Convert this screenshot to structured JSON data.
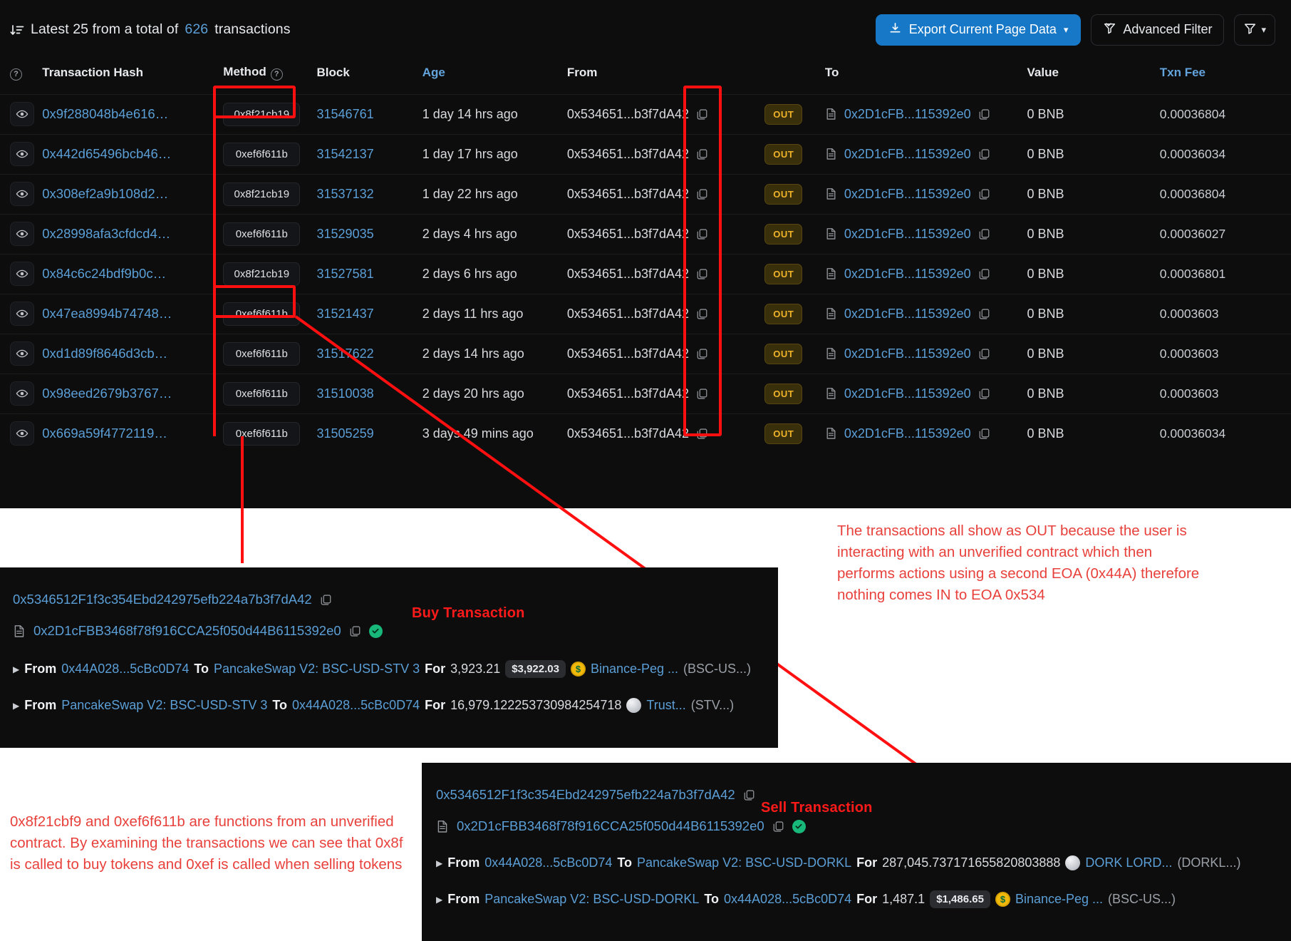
{
  "explorer": {
    "summary": {
      "prefix": "Latest 25 from a total of",
      "count": "626",
      "suffix": "transactions",
      "sort_icon": "sort-descending-icon"
    },
    "toolbar": {
      "export_label": "Export Current Page Data",
      "export_icon": "download-icon",
      "export_chevron": "chevron-down-icon",
      "advanced_filter_label": "Advanced Filter",
      "advanced_filter_icon": "funnel-check-icon",
      "filter_icon": "funnel-icon",
      "filter_chevron": "chevron-down-icon",
      "accent_color": "#1878c8"
    },
    "columns": {
      "help_icon": "question-circle-icon",
      "hash": "Transaction Hash",
      "method": "Method",
      "block": "Block",
      "age": "Age",
      "from": "From",
      "to": "To",
      "value": "Value",
      "fee": "Txn Fee"
    },
    "rows": [
      {
        "eye": "eye-icon",
        "hash": "0x9f288048b4e616…",
        "method": "0x8f21cb19",
        "block": "31546761",
        "age": "1 day 14 hrs ago",
        "from": "0x534651...b3f7dA42",
        "dir": "OUT",
        "to": "0x2D1cFB...115392e0",
        "value": "0 BNB",
        "fee": "0.00036804"
      },
      {
        "eye": "eye-icon",
        "hash": "0x442d65496bcb46…",
        "method": "0xef6f611b",
        "block": "31542137",
        "age": "1 day 17 hrs ago",
        "from": "0x534651...b3f7dA42",
        "dir": "OUT",
        "to": "0x2D1cFB...115392e0",
        "value": "0 BNB",
        "fee": "0.00036034"
      },
      {
        "eye": "eye-icon",
        "hash": "0x308ef2a9b108d2…",
        "method": "0x8f21cb19",
        "block": "31537132",
        "age": "1 day 22 hrs ago",
        "from": "0x534651...b3f7dA42",
        "dir": "OUT",
        "to": "0x2D1cFB...115392e0",
        "value": "0 BNB",
        "fee": "0.00036804"
      },
      {
        "eye": "eye-icon",
        "hash": "0x28998afa3cfdcd4…",
        "method": "0xef6f611b",
        "block": "31529035",
        "age": "2 days 4 hrs ago",
        "from": "0x534651...b3f7dA42",
        "dir": "OUT",
        "to": "0x2D1cFB...115392e0",
        "value": "0 BNB",
        "fee": "0.00036027"
      },
      {
        "eye": "eye-icon",
        "hash": "0x84c6c24bdf9b0c…",
        "method": "0x8f21cb19",
        "block": "31527581",
        "age": "2 days 6 hrs ago",
        "from": "0x534651...b3f7dA42",
        "dir": "OUT",
        "to": "0x2D1cFB...115392e0",
        "value": "0 BNB",
        "fee": "0.00036801"
      },
      {
        "eye": "eye-icon",
        "hash": "0x47ea8994b74748…",
        "method": "0xef6f611b",
        "block": "31521437",
        "age": "2 days 11 hrs ago",
        "from": "0x534651...b3f7dA42",
        "dir": "OUT",
        "to": "0x2D1cFB...115392e0",
        "value": "0 BNB",
        "fee": "0.0003603"
      },
      {
        "eye": "eye-icon",
        "hash": "0xd1d89f8646d3cb…",
        "method": "0xef6f611b",
        "block": "31517622",
        "age": "2 days 14 hrs ago",
        "from": "0x534651...b3f7dA42",
        "dir": "OUT",
        "to": "0x2D1cFB...115392e0",
        "value": "0 BNB",
        "fee": "0.0003603"
      },
      {
        "eye": "eye-icon",
        "hash": "0x98eed2679b3767…",
        "method": "0xef6f611b",
        "block": "31510038",
        "age": "2 days 20 hrs ago",
        "from": "0x534651...b3f7dA42",
        "dir": "OUT",
        "to": "0x2D1cFB...115392e0",
        "value": "0 BNB",
        "fee": "0.0003603"
      },
      {
        "eye": "eye-icon",
        "hash": "0x669a59f4772119…",
        "method": "0xef6f611b",
        "block": "31505259",
        "age": "3 days 49 mins ago",
        "from": "0x534651...b3f7dA42",
        "dir": "OUT",
        "to": "0x2D1cFB...115392e0",
        "value": "0 BNB",
        "fee": "0.00036034"
      }
    ]
  },
  "annotations": {
    "highlight_color": "#ff0f0f",
    "out_note": "The transactions all show as OUT because the user is interacting with an unverified contract which then performs actions using a second EOA (0x44A) therefore nothing comes IN to EOA 0x534",
    "method_note": "0x8f21cbf9 and 0xef6f611b are functions from an unverified contract. By examining the transactions we can see that 0x8f is called to buy tokens and 0xef is called when selling tokens",
    "buy_title": "Buy Transaction",
    "sell_title": "Sell Transaction"
  },
  "buy_panel": {
    "from_address": "0x5346512F1f3c354Ebd242975efb224a7b3f7dA42",
    "contract_address": "0x2D1cFBB3468f78f916CCA25f050d44B6115392e0",
    "verified_icon": "check-circle-icon",
    "copy_icon": "copy-icon",
    "doc_icon": "contract-doc-icon",
    "transfers": [
      {
        "from_label": "From",
        "from_value": "0x44A028...5cBc0D74",
        "to_label": "To",
        "to_value": "PancakeSwap V2: BSC-USD-STV 3",
        "for_label": "For",
        "amount": "3,923.21",
        "usd": "$3,922.03",
        "token_icon": "usd-coin-icon",
        "token": "Binance-Peg ...",
        "token_symbol": "(BSC-US...)"
      },
      {
        "from_label": "From",
        "from_value": "PancakeSwap V2: BSC-USD-STV 3",
        "to_label": "To",
        "to_value": "0x44A028...5cBc0D74",
        "for_label": "For",
        "amount": "16,979.122253730984254718",
        "usd": "",
        "token_icon": "silver-coin-icon",
        "token": "Trust...",
        "token_symbol": "(STV...)"
      }
    ]
  },
  "sell_panel": {
    "from_address": "0x5346512F1f3c354Ebd242975efb224a7b3f7dA42",
    "contract_address": "0x2D1cFBB3468f78f916CCA25f050d44B6115392e0",
    "verified_icon": "check-circle-icon",
    "copy_icon": "copy-icon",
    "doc_icon": "contract-doc-icon",
    "transfers": [
      {
        "from_label": "From",
        "from_value": "0x44A028...5cBc0D74",
        "to_label": "To",
        "to_value": "PancakeSwap V2: BSC-USD-DORKL",
        "for_label": "For",
        "amount": "287,045.737171655820803888",
        "usd": "",
        "token_icon": "silver-coin-icon",
        "token": "DORK LORD...",
        "token_symbol": "(DORKL...)"
      },
      {
        "from_label": "From",
        "from_value": "PancakeSwap V2: BSC-USD-DORKL",
        "to_label": "To",
        "to_value": "0x44A028...5cBc0D74",
        "for_label": "For",
        "amount": "1,487.1",
        "usd": "$1,486.65",
        "token_icon": "usd-coin-icon",
        "token": "Binance-Peg ...",
        "token_symbol": "(BSC-US...)"
      }
    ]
  }
}
